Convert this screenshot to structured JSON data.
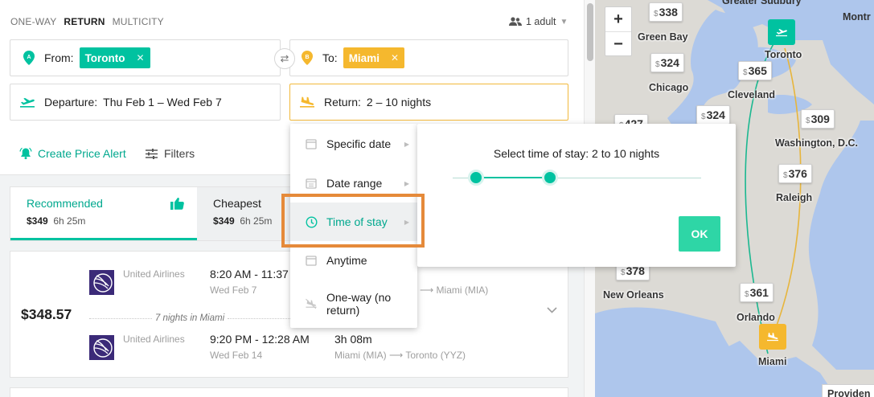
{
  "trip_types": [
    "ONE-WAY",
    "RETURN",
    "MULTICITY"
  ],
  "passengers": "1 adult",
  "from": {
    "label": "From:",
    "value": "Toronto"
  },
  "to": {
    "label": "To:",
    "value": "Miami"
  },
  "departure": {
    "label": "Departure:",
    "value": "Thu Feb 1 – Wed Feb 7"
  },
  "return": {
    "label": "Return:",
    "value": "2 – 10 nights"
  },
  "actions": {
    "alert": "Create Price Alert",
    "filters": "Filters"
  },
  "tabs": [
    {
      "title": "Recommended",
      "price": "$349",
      "duration": "6h 25m"
    },
    {
      "title": "Cheapest",
      "price": "$349",
      "duration": "6h 25m"
    }
  ],
  "result": {
    "price": "$348.57",
    "outbound": {
      "airline": "United Airlines",
      "time": "8:20 AM - 11:37",
      "date": "Wed Feb 7",
      "dest": "Miami (MIA)"
    },
    "stay": "7 nights in Miami",
    "inbound": {
      "airline": "United Airlines",
      "time": "9:20 PM - 12:28 AM",
      "date": "Wed Feb 14",
      "duration": "3h 08m",
      "origin": "Miami (MIA)",
      "dest": "Toronto (YYZ)"
    }
  },
  "dropdown": {
    "options": [
      "Specific date",
      "Date range",
      "Time of stay",
      "Anytime",
      "One-way (no return)"
    ],
    "selected": "Time of stay"
  },
  "stay_popup": {
    "title": "Select time of stay: 2 to 10 nights",
    "ok": "OK",
    "range_fraction": [
      0.094,
      0.391
    ]
  },
  "map": {
    "zoom_in": "+",
    "zoom_out": "−",
    "currency": "$",
    "prices": [
      "338",
      "324",
      "365",
      "427",
      "324",
      "309",
      "376",
      "378",
      "361"
    ],
    "cities": [
      "Greater Sudbury",
      "Montr",
      "Green Bay",
      "Toronto",
      "Chicago",
      "Cleveland",
      "Washington, D.C.",
      "Raleigh",
      "New Orleans",
      "Orlando",
      "Miami",
      "Providen"
    ]
  },
  "colors": {
    "accent": "#00c2a0",
    "amber": "#f5b82e",
    "highlight": "#e58a3a"
  }
}
